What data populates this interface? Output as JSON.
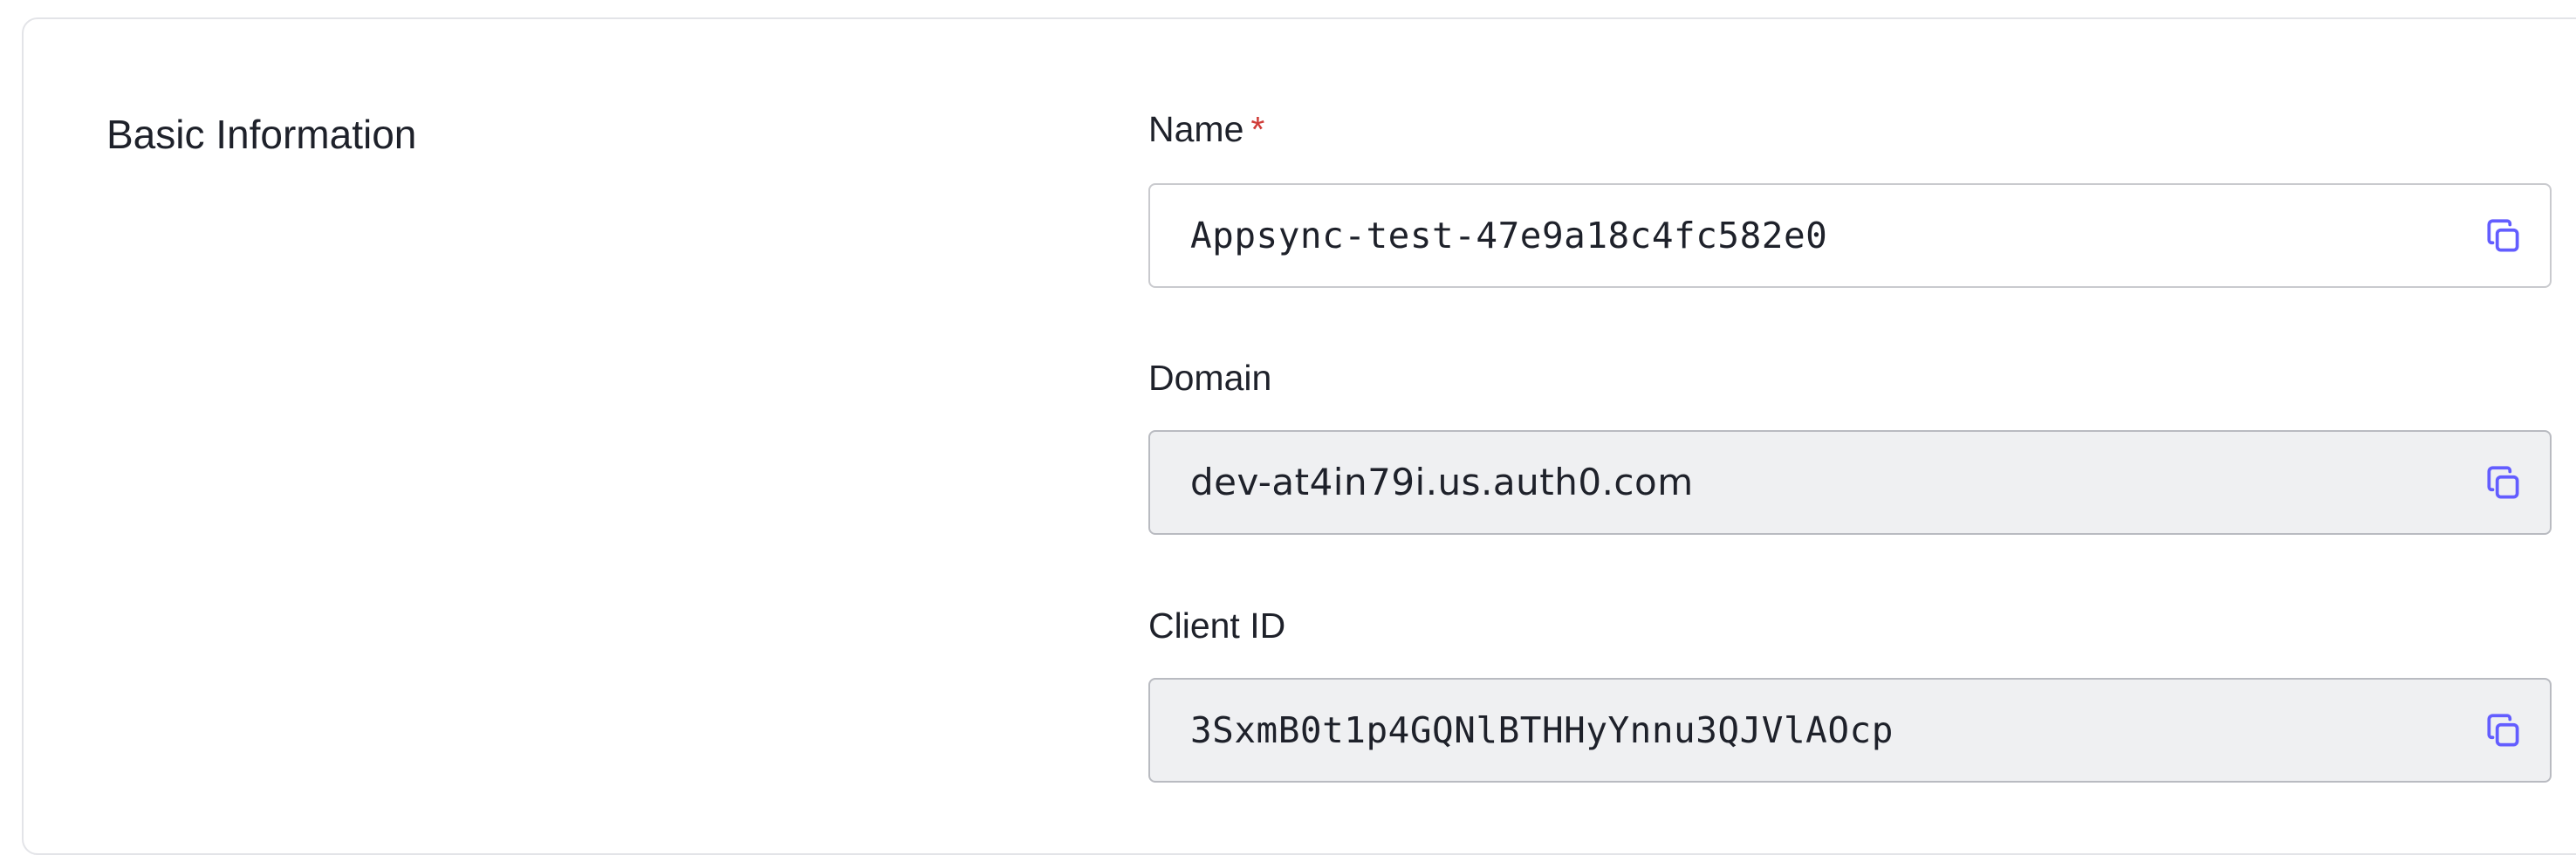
{
  "section": {
    "title": "Basic Information"
  },
  "fields": {
    "name": {
      "label": "Name",
      "required_mark": "*",
      "value": "Appsync-test-47e9a18c4fc582e0",
      "copy_icon": "copy-icon"
    },
    "domain": {
      "label": "Domain",
      "value": "dev-at4in79i.us.auth0.com",
      "copy_icon": "copy-icon"
    },
    "client_id": {
      "label": "Client ID",
      "value": "3SxmB0t1p4GQNlBTHHyYnnu3QJVlAOcp",
      "copy_icon": "copy-icon"
    }
  },
  "colors": {
    "accent": "#635dff",
    "required": "#d03c38",
    "text": "#1e212a",
    "readonly_bg": "#eff0f2"
  }
}
